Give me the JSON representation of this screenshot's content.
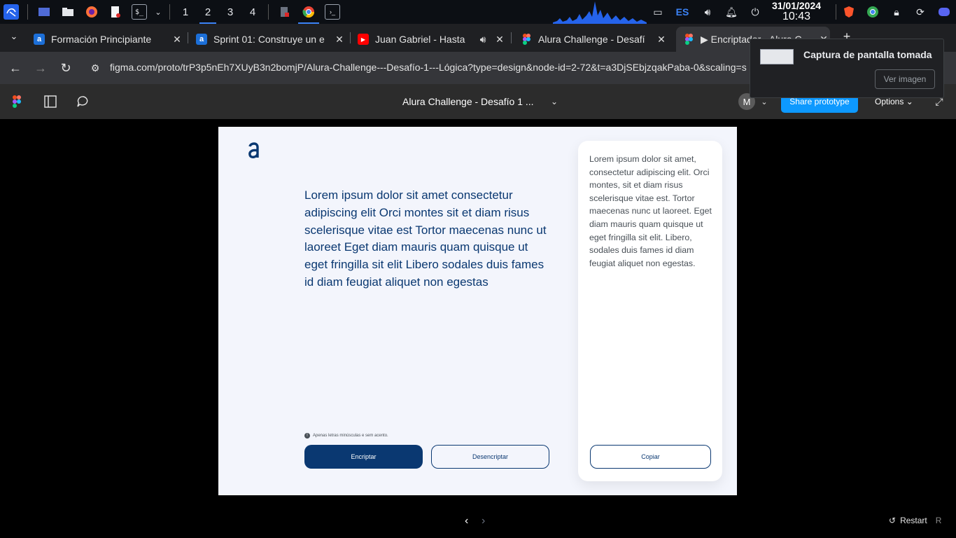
{
  "taskbar": {
    "workspaces": [
      "1",
      "2",
      "3",
      "4"
    ],
    "active_workspace": "2",
    "keyboard_layout": "ES",
    "date": "31/01/2024",
    "time": "10:43"
  },
  "tabs": [
    {
      "title": "Formación Principiante",
      "favicon": "a",
      "color": "#1c6fd8"
    },
    {
      "title": "Sprint 01: Construye un e",
      "favicon": "a",
      "color": "#1c6fd8"
    },
    {
      "title": "Juan Gabriel - Hasta",
      "favicon": "youtube-icon",
      "color": "#ff0000"
    },
    {
      "title": "Alura Challenge - Desafí",
      "favicon": "figma-icon",
      "color": "#f24e1e"
    },
    {
      "title": "▶ Encriptador - Alura C",
      "favicon": "figma-icon",
      "color": "#f24e1e"
    }
  ],
  "address_bar": {
    "url": "figma.com/proto/trP3p5nEh7XUyB3n2bomjP/Alura-Challenge---Desafío-1---Lógica?type=design&node-id=2-72&t=a3DjSEbjzqakPaba-0&scaling=s..."
  },
  "notification": {
    "message": "Captura de pantalla tomada",
    "action": "Ver imagen"
  },
  "figma": {
    "document_title": "Alura Challenge - Desafío 1 ...",
    "avatar_initial": "M",
    "share_label": "Share prototype",
    "options_label": "Options",
    "restart_label": "Restart",
    "restart_key": "R"
  },
  "prototype": {
    "main_text": "Lorem ipsum dolor sit amet consectetur adipiscing elit Orci montes sit et diam risus scelerisque vitae est Tortor maecenas nunc ut laoreet Eget diam mauris quam quisque ut eget fringilla sit elit Libero sodales duis fames id diam feugiat aliquet non egestas",
    "hint": "Apenas letras minúsculas e sem acento.",
    "encrypt_label": "Encriptar",
    "decrypt_label": "Desencriptar",
    "output_text": "Lorem ipsum dolor sit amet, consectetur adipiscing elit. Orci montes, sit et diam risus scelerisque vitae est. Tortor maecenas nunc ut laoreet. Eget diam mauris quam quisque ut eget fringilla sit elit. Libero, sodales duis fames id diam feugiat aliquet non egestas.",
    "copy_label": "Copiar",
    "colors": {
      "primary": "#0a3871",
      "background": "#f3f5fc",
      "text_secondary": "#495057"
    }
  }
}
